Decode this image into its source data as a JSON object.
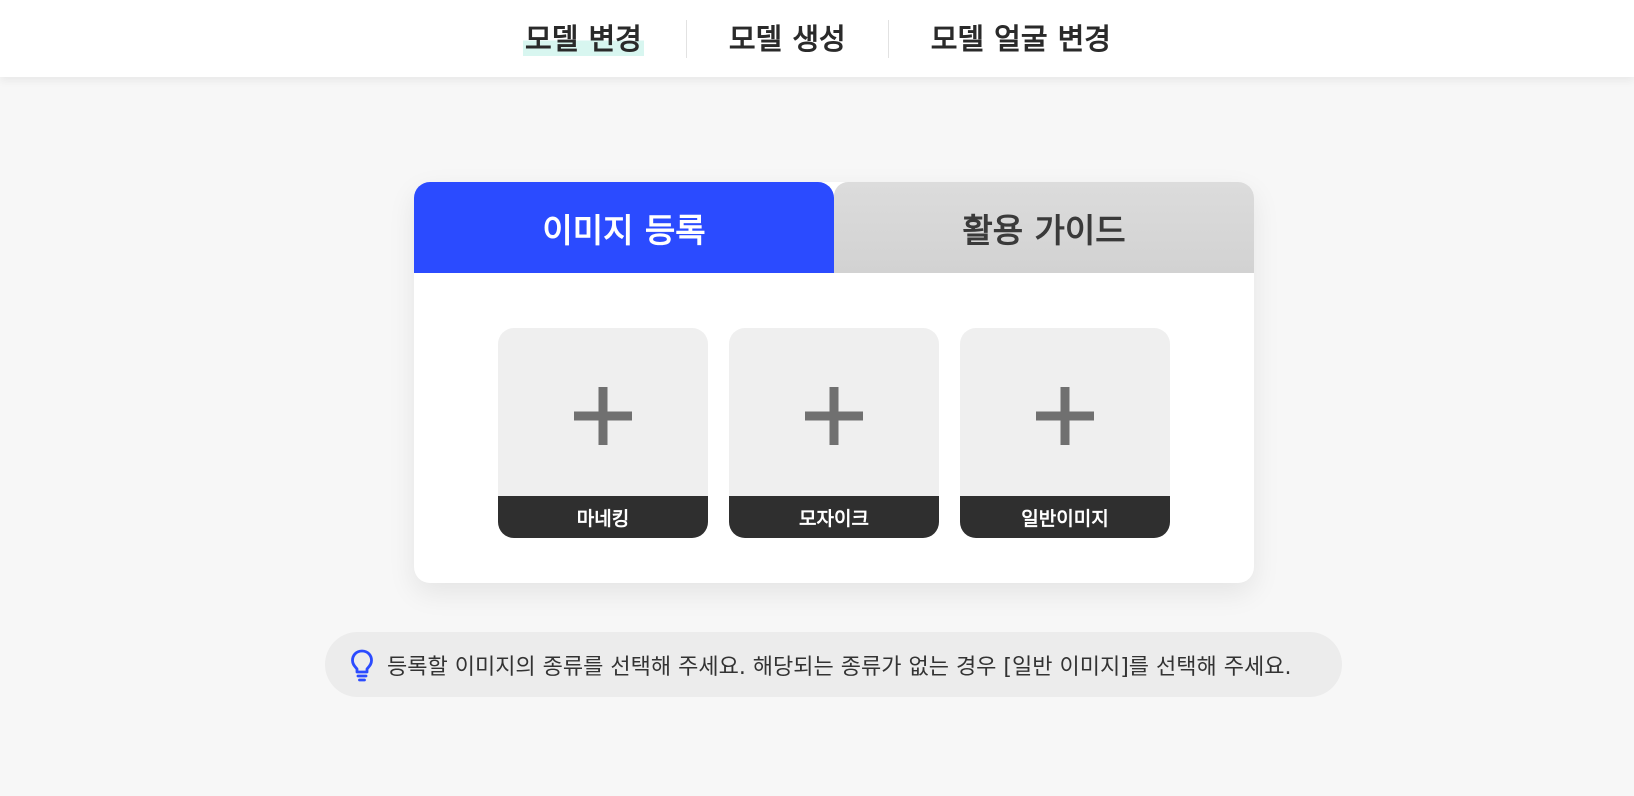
{
  "nav": {
    "tabs": [
      {
        "label": "모델 변경",
        "active": true
      },
      {
        "label": "모델 생성",
        "active": false
      },
      {
        "label": "모델 얼굴 변경",
        "active": false
      }
    ]
  },
  "panel": {
    "tabs": [
      {
        "label": "이미지 등록",
        "active": true
      },
      {
        "label": "활용 가이드",
        "active": false
      }
    ],
    "cards": [
      {
        "label": "마네킹"
      },
      {
        "label": "모자이크"
      },
      {
        "label": "일반이미지"
      }
    ]
  },
  "tip": {
    "icon": "lightbulb-icon",
    "text": "등록할 이미지의 종류를 선택해 주세요. 해당되는 종류가 없는 경우 [일반 이미지]를 선택해 주세요."
  },
  "colors": {
    "accent": "#2b4bff",
    "nav_highlight": "#d8f6f0",
    "card_label_bg": "#2f2f2f"
  }
}
